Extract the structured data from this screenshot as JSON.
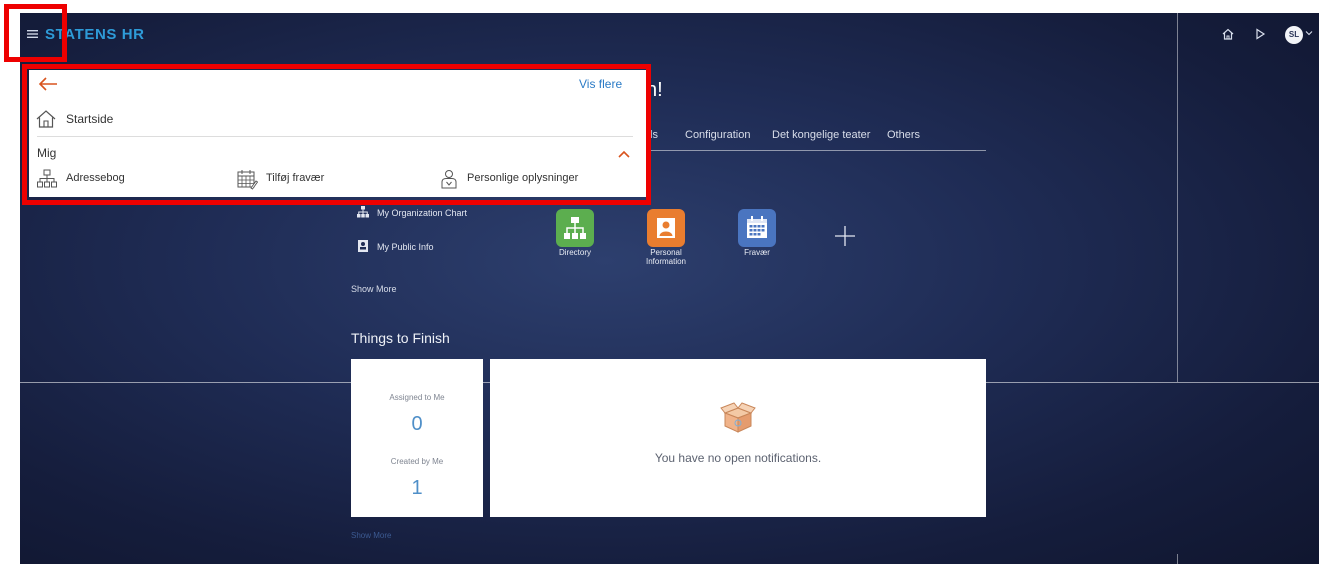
{
  "header": {
    "brand": "STATENS HR",
    "avatar_initials": "SL",
    "icons": [
      "home-icon",
      "play-icon"
    ]
  },
  "greeting": {
    "visible_fragment": "n!"
  },
  "tabs": [
    {
      "label": "ls"
    },
    {
      "label": "Configuration"
    },
    {
      "label": "Det kongelige teater"
    },
    {
      "label": "Others"
    }
  ],
  "quick_links": {
    "items": [
      {
        "label": "My Organization Chart",
        "icon": "org-chart-icon"
      },
      {
        "label": "My Public Info",
        "icon": "id-badge-icon"
      }
    ],
    "show_more": "Show More"
  },
  "apps": {
    "items": [
      {
        "label": "Directory",
        "color": "#5cae4f",
        "icon": "directory-icon"
      },
      {
        "label": "Personal Information",
        "color": "#e97d2f",
        "icon": "person-icon"
      },
      {
        "label": "Fravær",
        "color": "#4a75c0",
        "icon": "calendar-icon"
      }
    ]
  },
  "things_to_finish": {
    "title": "Things to Finish",
    "assigned_label": "Assigned to Me",
    "assigned_count": "0",
    "created_label": "Created by Me",
    "created_count": "1",
    "notifications_empty": "You have no open notifications.",
    "show_more": "Show More"
  },
  "popup": {
    "more_label": "Vis flere",
    "home_label": "Startside",
    "section_title": "Mig",
    "items": [
      {
        "label": "Adressebog",
        "icon": "address-book-icon"
      },
      {
        "label": "Tilføj fravær",
        "icon": "calendar-icon"
      },
      {
        "label": "Personlige oplysninger",
        "icon": "person-icon"
      }
    ]
  },
  "colors": {
    "accent": "#2e9bd8",
    "popup_accent": "#d9541e",
    "link": "#2b7bc6",
    "highlight": "#ee0000"
  }
}
